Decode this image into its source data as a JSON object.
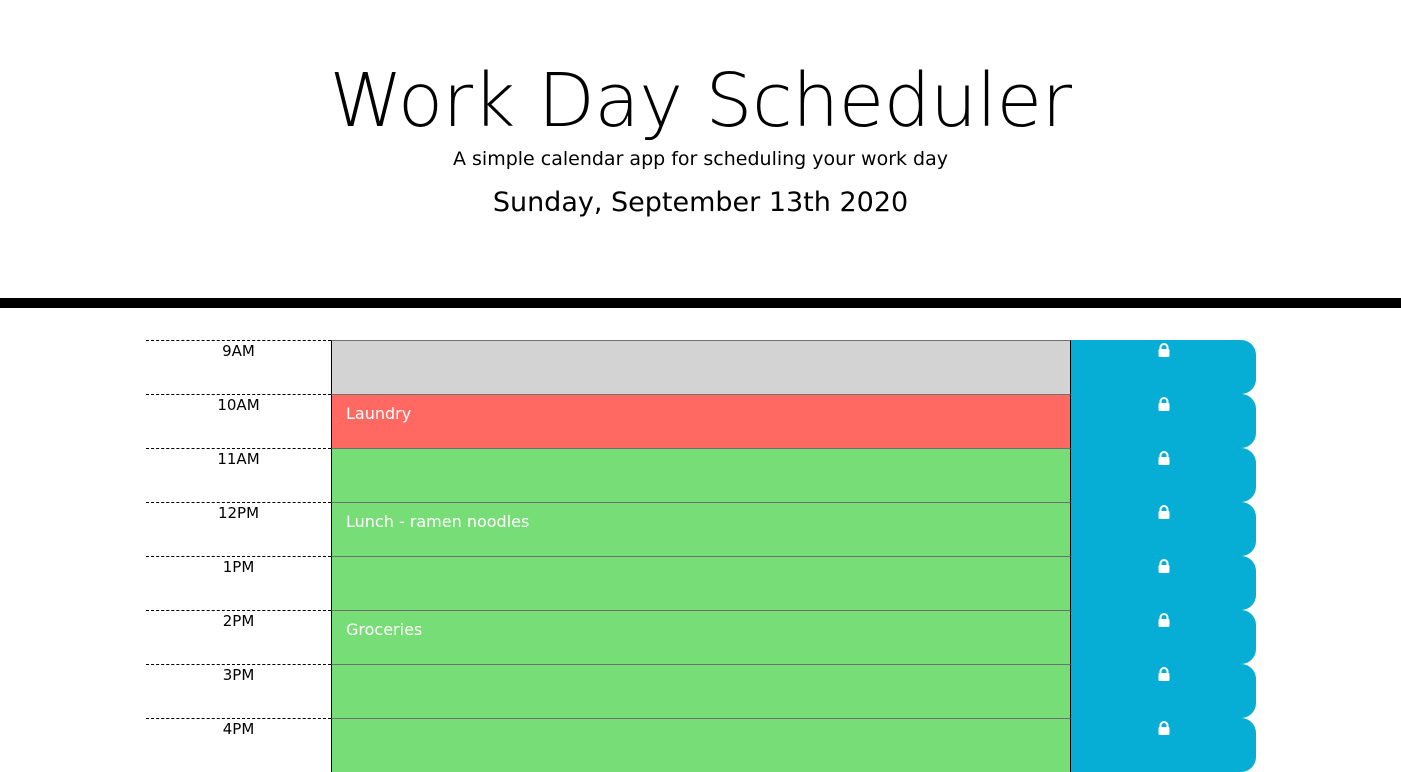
{
  "header": {
    "title": "Work Day Scheduler",
    "lead": "A simple calendar app for scheduling your work day",
    "current_day": "Sunday, September 13th 2020"
  },
  "colors": {
    "past": "#d3d3d3",
    "present": "#ff6961",
    "future": "#77dd77",
    "save_button": "#06aed5"
  },
  "schedule": {
    "save_icon": "lock-icon",
    "blocks": [
      {
        "hour": "9AM",
        "text": "",
        "status": "past"
      },
      {
        "hour": "10AM",
        "text": "Laundry",
        "status": "present"
      },
      {
        "hour": "11AM",
        "text": "",
        "status": "future"
      },
      {
        "hour": "12PM",
        "text": "Lunch - ramen noodles",
        "status": "future"
      },
      {
        "hour": "1PM",
        "text": "",
        "status": "future"
      },
      {
        "hour": "2PM",
        "text": "Groceries",
        "status": "future"
      },
      {
        "hour": "3PM",
        "text": "",
        "status": "future"
      },
      {
        "hour": "4PM",
        "text": "",
        "status": "future"
      }
    ]
  }
}
